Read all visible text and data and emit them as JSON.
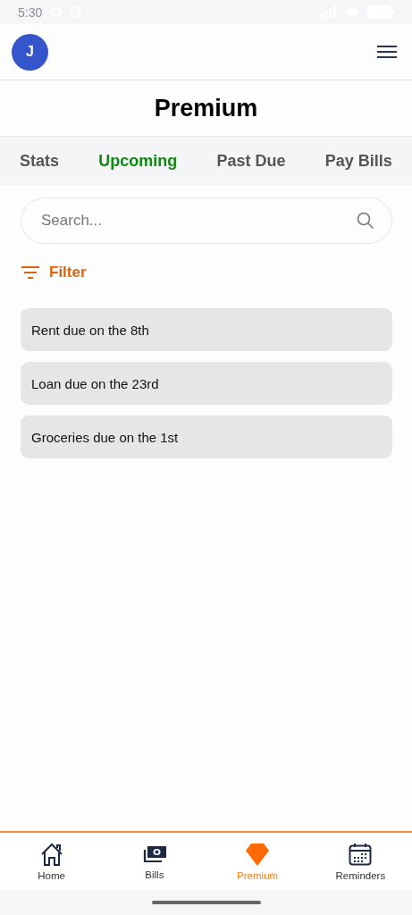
{
  "status_bar": {
    "time": "5:30"
  },
  "header": {
    "avatar": "J"
  },
  "title": "Premium",
  "tabs": [
    {
      "label": "Stats",
      "selected": false
    },
    {
      "label": "Upcoming",
      "selected": true
    },
    {
      "label": "Past Due",
      "selected": false
    },
    {
      "label": "Pay Bills",
      "selected": false
    }
  ],
  "search": {
    "placeholder": "Search..."
  },
  "filter": {
    "label": "Filter"
  },
  "reminders": [
    "Rent due on the 8th",
    "Loan due on the 23rd",
    "Groceries due on the 1st"
  ],
  "bottom_nav": [
    {
      "label": "Home",
      "kind": "home",
      "selected": false
    },
    {
      "label": "Bills",
      "kind": "bills",
      "selected": false
    },
    {
      "label": "Premium",
      "kind": "premium",
      "selected": true
    },
    {
      "label": "Reminders",
      "kind": "reminders",
      "selected": false
    }
  ]
}
